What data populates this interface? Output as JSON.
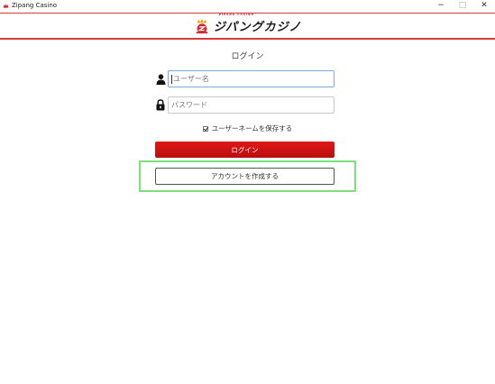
{
  "window": {
    "title": "Zipang Casino",
    "controls": {
      "minimize": "−",
      "maximize": "□",
      "close": "✕"
    }
  },
  "header": {
    "logo_text": "ジパングカジノ",
    "logo_subtext": "ZIPANG CASINO",
    "logo_icon": "zipang-crest-icon"
  },
  "login": {
    "title": "ログイン",
    "username": {
      "placeholder": "ユーザー名",
      "value": "",
      "icon": "user-icon"
    },
    "password": {
      "placeholder": "パスワード",
      "value": "",
      "icon": "lock-icon"
    },
    "remember_label": "ユーザーネームを保存する",
    "remember_checked": true,
    "login_button": "ログイン",
    "create_account_button": "アカウントを作成する"
  },
  "colors": {
    "brand_red": "#d83a3a",
    "button_red": "#c41212",
    "highlight_green": "#7ce07c",
    "focus_blue": "#7ea8d8"
  }
}
